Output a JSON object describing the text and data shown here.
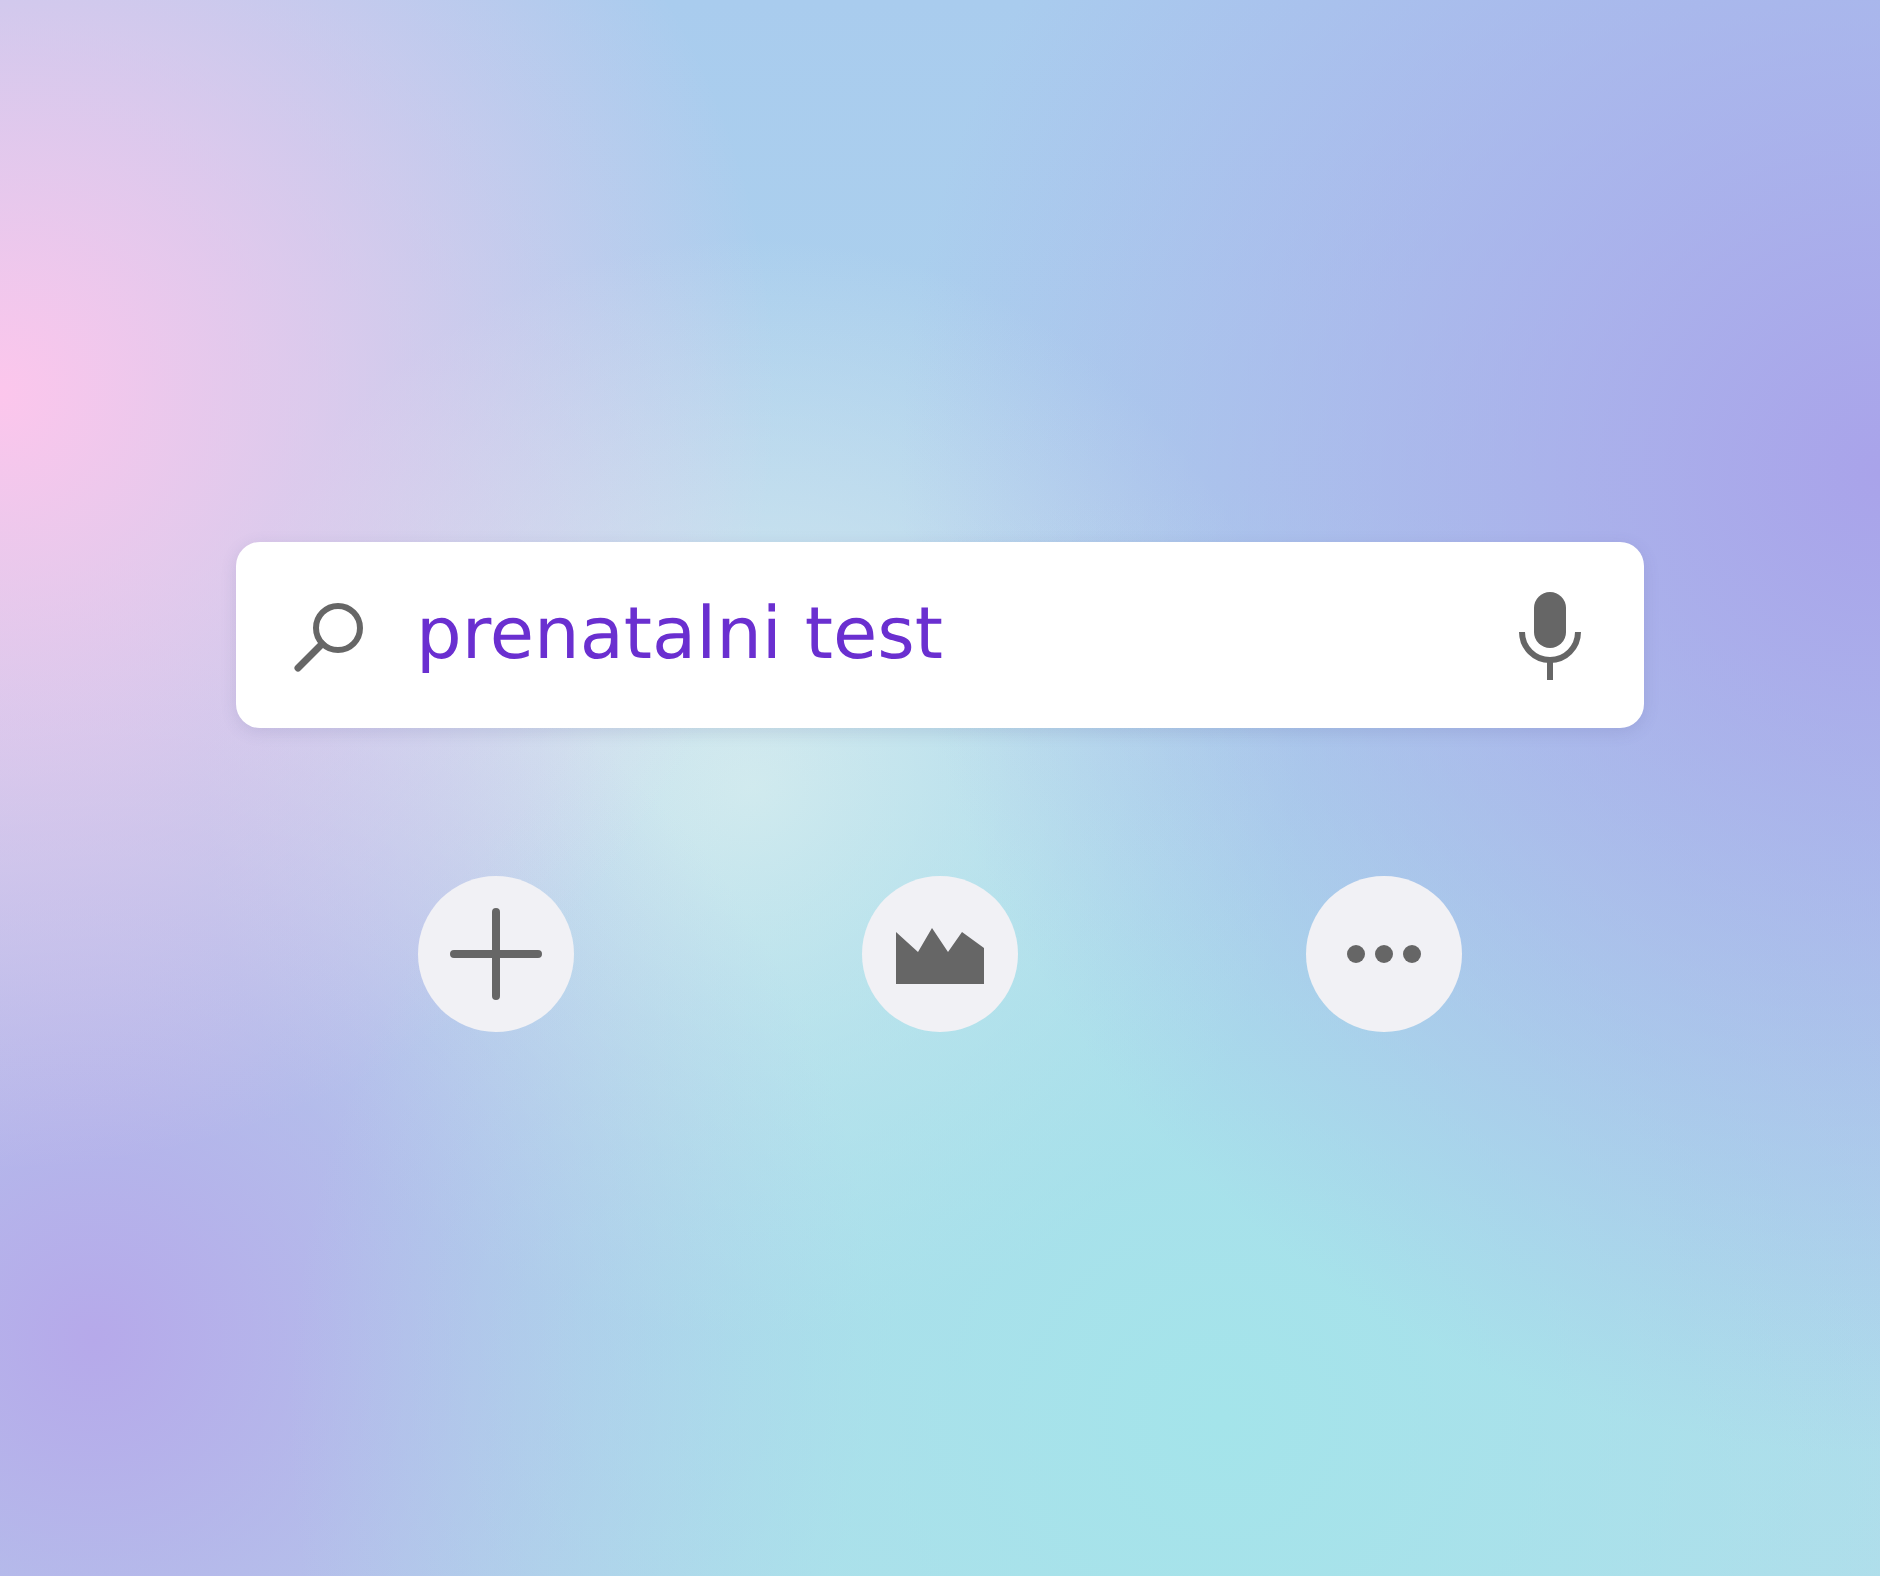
{
  "search": {
    "value": "prenatalni test"
  },
  "actions": [
    {
      "kind": "add"
    },
    {
      "kind": "crown"
    },
    {
      "kind": "more"
    }
  ]
}
